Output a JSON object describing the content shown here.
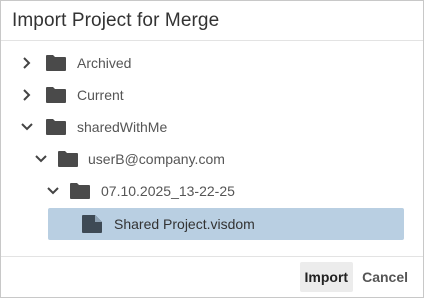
{
  "dialog": {
    "title": "Import Project for Merge"
  },
  "tree": {
    "items": [
      {
        "label": "Archived",
        "type": "folder",
        "expanded": false
      },
      {
        "label": "Current",
        "type": "folder",
        "expanded": false
      },
      {
        "label": "sharedWithMe",
        "type": "folder",
        "expanded": true
      },
      {
        "label": "userB@company.com",
        "type": "folder",
        "expanded": true
      },
      {
        "label": "07.10.2025_13-22-25",
        "type": "folder",
        "expanded": true
      },
      {
        "label": "Shared Project.visdom",
        "type": "file",
        "selected": true
      }
    ]
  },
  "buttons": {
    "import_label": "Import",
    "cancel_label": "Cancel"
  },
  "colors": {
    "selection": "#b9cfe2",
    "icon": "#4a4a4a"
  }
}
